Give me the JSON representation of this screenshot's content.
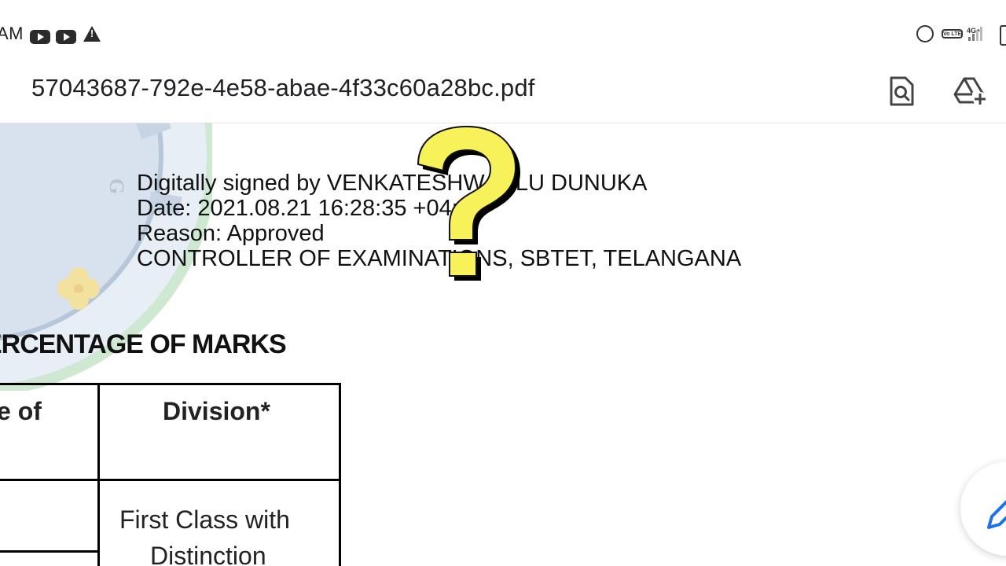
{
  "status_bar": {
    "time_fragment": "AM",
    "network_type": "4G+",
    "volte_label": "Vo LTE",
    "icons": [
      "youtube-icon",
      "youtube-icon",
      "warning-icon",
      "alarm-icon",
      "volte-icon",
      "signal-icon",
      "battery-icon"
    ]
  },
  "toolbar": {
    "file_name": "57043687-792e-4e58-abae-4f33c60a28bc.pdf",
    "actions": [
      "find-in-page-icon",
      "add-to-drive-icon"
    ]
  },
  "document": {
    "signature": {
      "line1": "Digitally signed by VENKATESHWARLU DUNUKA",
      "line2": "Date: 2021.08.21 16:28:35 +04:00",
      "line3": "Reason: Approved",
      "line4": "CONTROLLER OF EXAMINATIONS, SBTET, TELANGANA"
    },
    "section_heading": "ERCENTAGE OF MARKS",
    "table": {
      "headers": [
        "e of",
        "Division*"
      ],
      "row1_division_line1": "First Class with",
      "row1_division_line2": "Distinction"
    }
  },
  "overlay": {
    "question_mark_color": "#f7f25a"
  },
  "fab": {
    "icon": "edit-pencil-icon",
    "accent": "#1a73e8"
  }
}
